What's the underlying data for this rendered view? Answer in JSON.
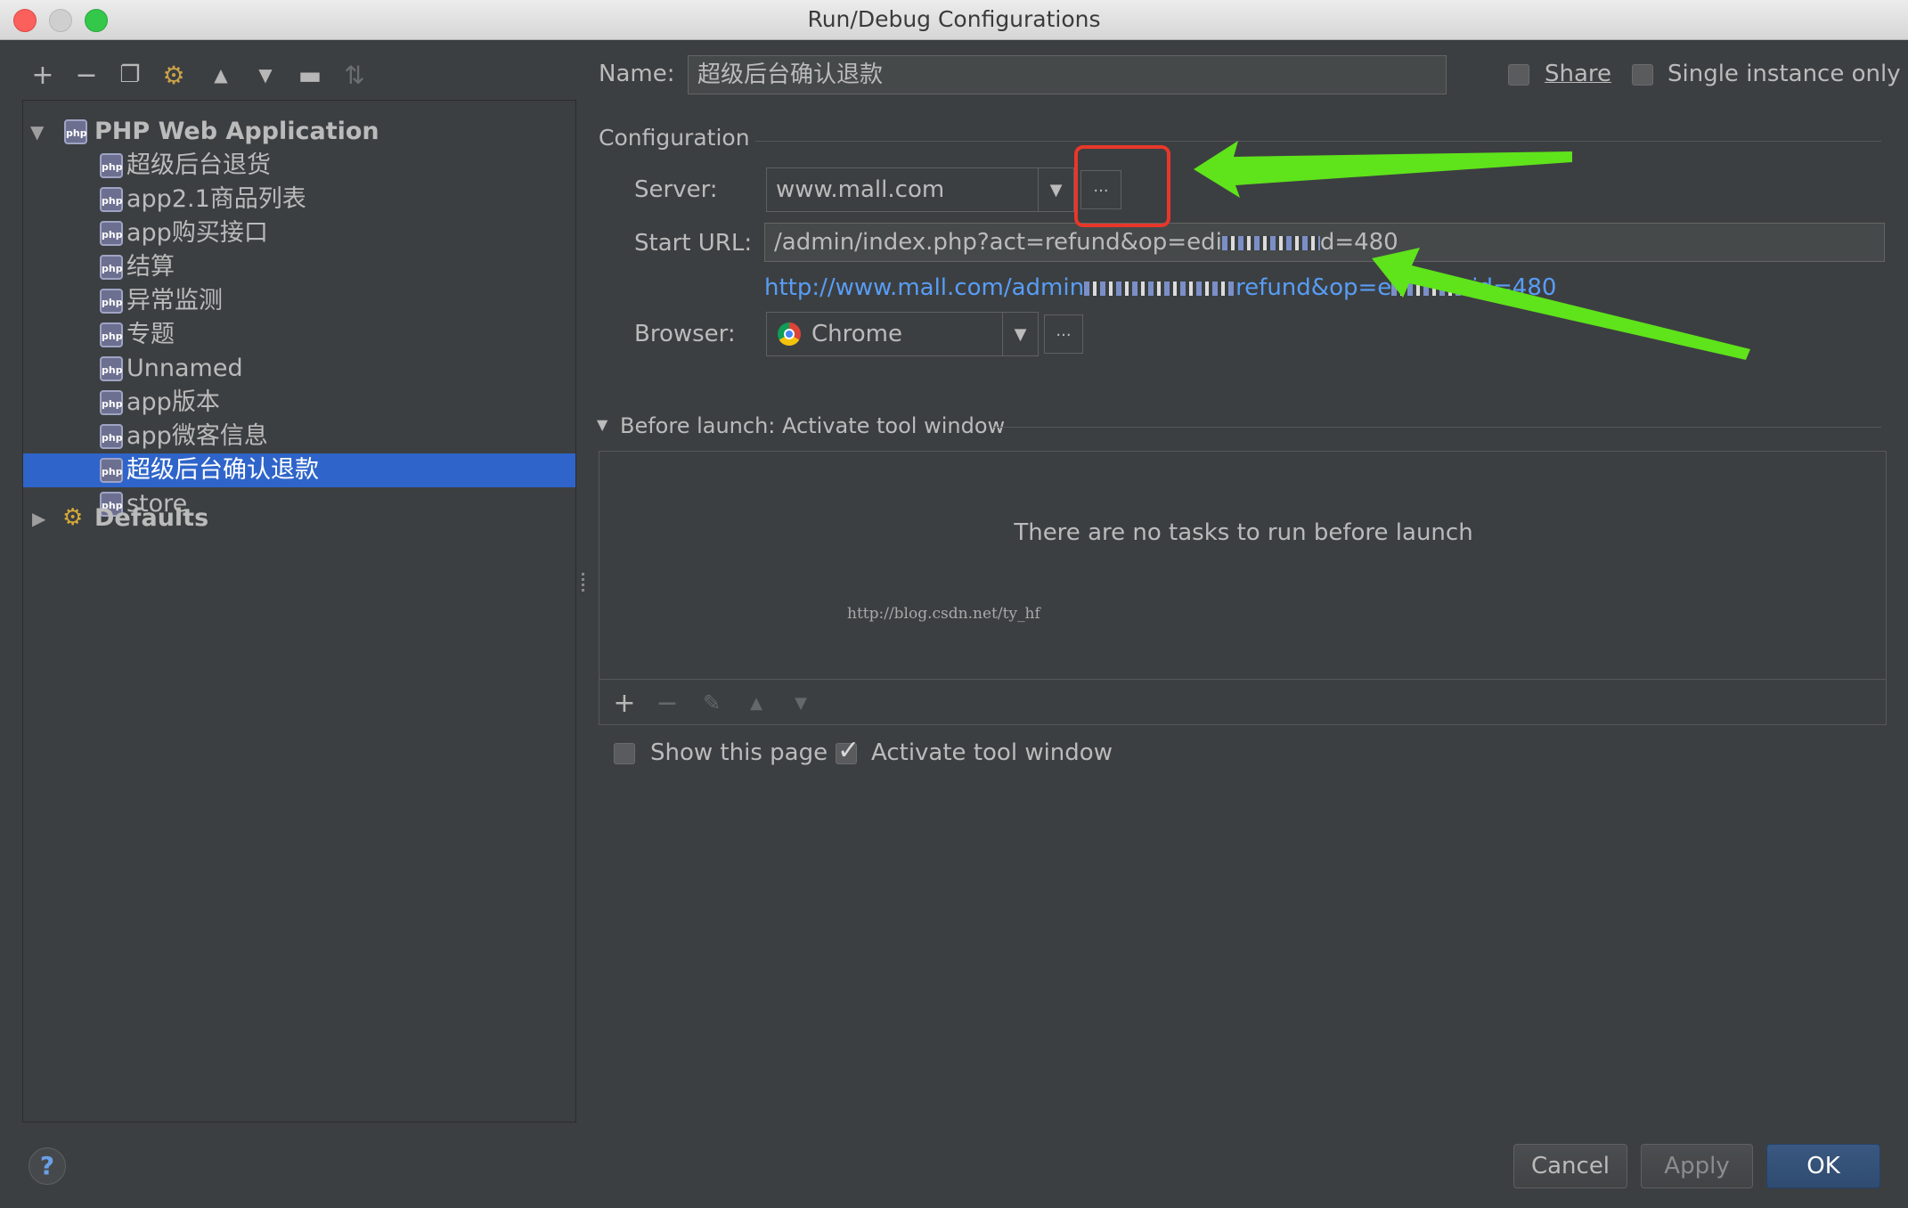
{
  "window": {
    "title": "Run/Debug Configurations"
  },
  "toolbar": {
    "icons": [
      "add-icon",
      "remove-icon",
      "copy-icon",
      "edit-defaults-icon",
      "move-up-icon",
      "move-down-icon",
      "folder-icon",
      "sort-icon"
    ],
    "glyphs": {
      "add": "+",
      "remove": "−",
      "copy": "❐",
      "edit": "⚙",
      "up": "▲",
      "down": "▼",
      "folder": "▬",
      "sort": "⇅"
    }
  },
  "tree": {
    "group_label": "PHP Web Application",
    "items": [
      {
        "label": "超级后台退货"
      },
      {
        "label": "app2.1商品列表"
      },
      {
        "label": "app购买接口"
      },
      {
        "label": "结算"
      },
      {
        "label": "异常监测"
      },
      {
        "label": "专题"
      },
      {
        "label": "Unnamed"
      },
      {
        "label": "app版本"
      },
      {
        "label": "app微客信息"
      },
      {
        "label": "超级后台确认退款",
        "selected": true
      },
      {
        "label": "store"
      }
    ],
    "defaults_label": "Defaults",
    "php_icon_text": "php"
  },
  "form": {
    "name_label": "Name:",
    "name_value": "超级后台确认退款",
    "share_label": "Share",
    "single_instance_label": "Single instance only",
    "configuration_label": "Configuration",
    "server_label": "Server:",
    "server_value": "www.mall.com",
    "start_url_label": "Start URL:",
    "start_url_prefix": "/admin/index.php?act=refund&op=edi",
    "start_url_suffix": "d=480",
    "resolved_url_prefix": "http://www.mall.com/admin",
    "resolved_url_mid": "refund&op=e",
    "resolved_url_suffix": "id=480",
    "browser_label": "Browser:",
    "browser_value": "Chrome",
    "ellipsis": "...",
    "combo_arrow": "▼"
  },
  "before_launch": {
    "header": "Before launch: Activate tool window",
    "empty_text": "There are no tasks to run before launch",
    "watermark": "http://blog.csdn.net/ty_hf",
    "tools": [
      "add-task-icon",
      "remove-task-icon",
      "edit-task-icon",
      "move-task-up-icon",
      "move-task-down-icon"
    ],
    "show_page_label": "Show this page",
    "show_page_checked": false,
    "activate_label": "Activate tool window",
    "activate_checked": true
  },
  "buttons": {
    "help": "?",
    "cancel": "Cancel",
    "apply": "Apply",
    "ok": "OK"
  },
  "colors": {
    "selection": "#2f65ca",
    "link": "#589df6",
    "annotation_red": "#e8372a",
    "annotation_green": "#5fe31b"
  }
}
